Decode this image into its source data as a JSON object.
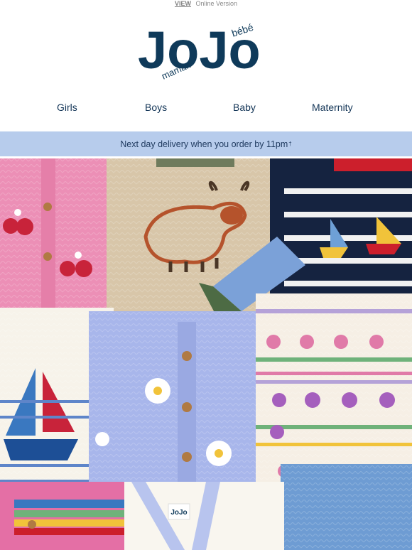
{
  "top_bar": {
    "view_label": "VIEW",
    "online_label": "Online Version"
  },
  "logo": {
    "brand_text": "JoJo",
    "tag_top": "bébé",
    "tag_side": "maman",
    "color": "#0f3a5a"
  },
  "nav": {
    "items": [
      {
        "label": "Girls"
      },
      {
        "label": "Boys"
      },
      {
        "label": "Baby"
      },
      {
        "label": "Maternity"
      }
    ]
  },
  "banner": {
    "text": "Next day delivery when you order by 11pm",
    "mark": "†",
    "bg": "#b7ccec"
  },
  "hero": {
    "image_subject": "knitted-sweaters-collection",
    "label_tag": "JoJo"
  }
}
